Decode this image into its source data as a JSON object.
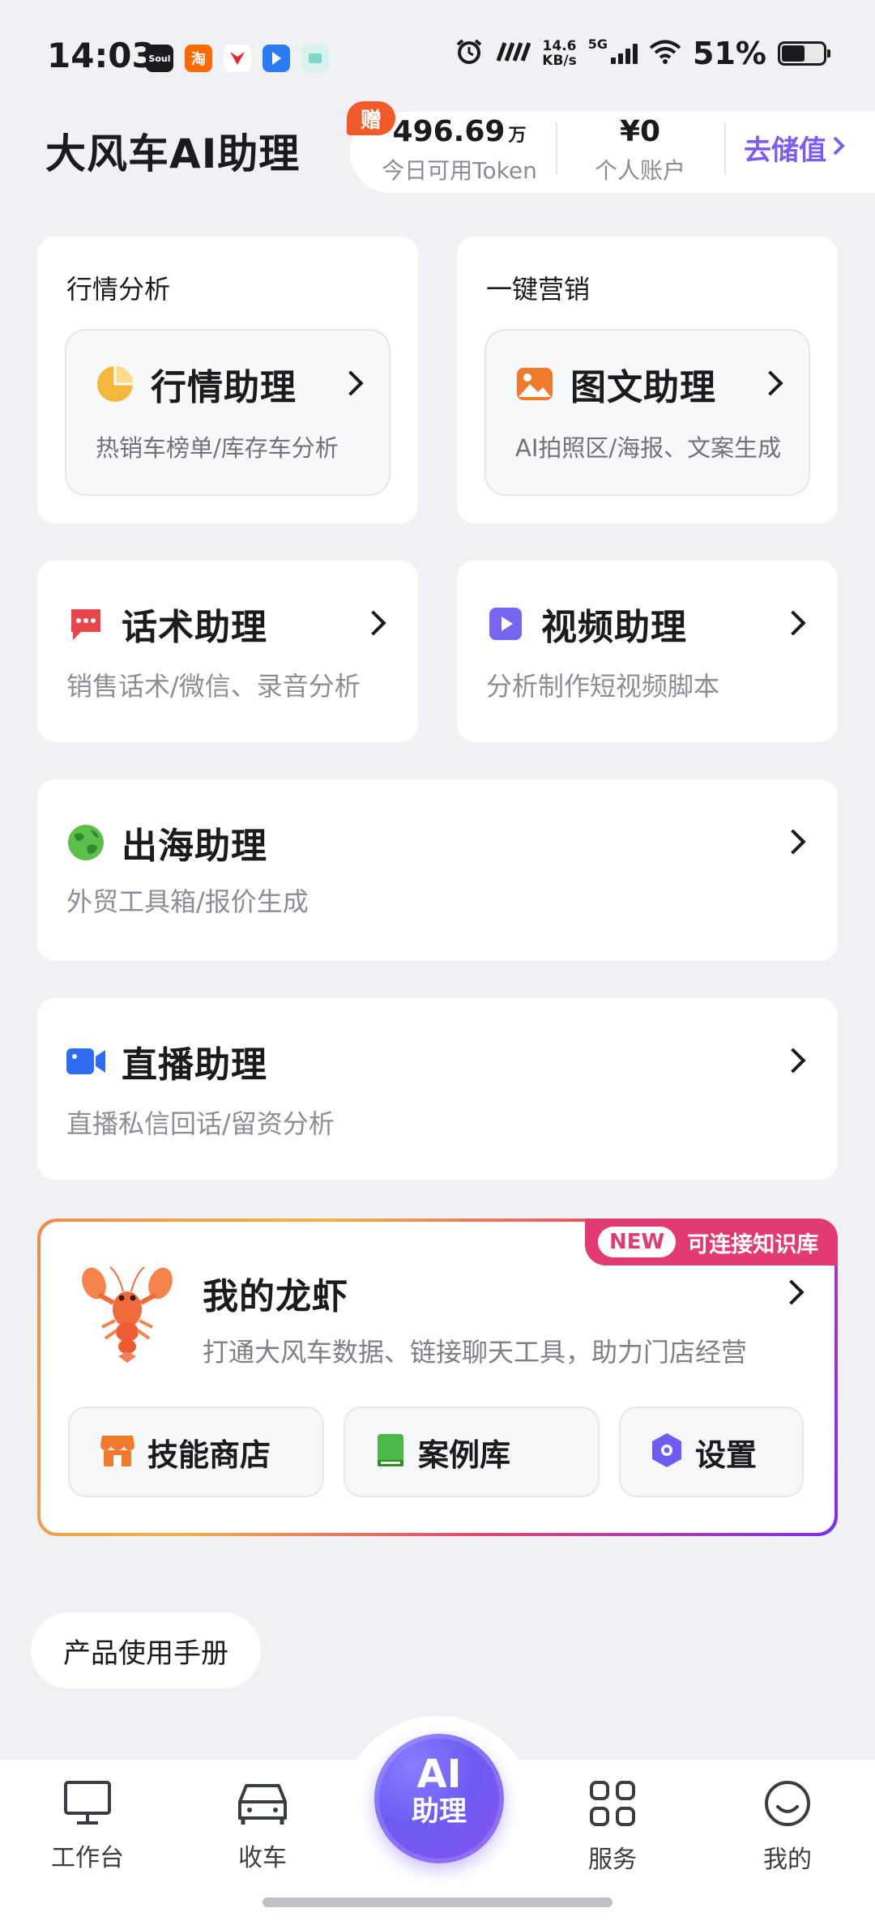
{
  "status_bar": {
    "time": "14:03",
    "apps": [
      {
        "icon": "soul-app-icon",
        "label": "Soul",
        "color": "#1b1b1f"
      },
      {
        "icon": "taobao-app-icon",
        "label": "淘",
        "color": "#ff6a00"
      },
      {
        "icon": "app-red-icon",
        "label": "",
        "color": "#ffffff"
      },
      {
        "icon": "app-blue-icon",
        "label": "",
        "color": "#2b7bf2"
      },
      {
        "icon": "app-teal-icon",
        "label": "",
        "color": "#7fd6c9"
      }
    ],
    "net_speed_value": "14.6",
    "net_speed_unit": "KB/s",
    "network": "5G",
    "battery_percent": "51%"
  },
  "header": {
    "title": "大风车AI助理",
    "gift_badge": "赠",
    "token_value": "496.69",
    "token_unit": "万",
    "token_label": "今日可用Token",
    "account_value": "¥0",
    "account_label": "个人账户",
    "recharge_label": "去储值"
  },
  "market_card": {
    "section_title": "行情分析",
    "title": "行情助理",
    "subtitle": "热销车榜单/库存车分析",
    "icon": "pie-chart-icon",
    "icon_color": "#f5b73b"
  },
  "marketing_card": {
    "section_title": "一键营销",
    "title": "图文助理",
    "subtitle": "AI拍照区/海报、文案生成",
    "icon": "image-icon",
    "icon_color": "#f07a2c"
  },
  "script_card": {
    "title": "话术助理",
    "subtitle": "销售话术/微信、录音分析",
    "icon": "chat-icon",
    "icon_color": "#e8464a"
  },
  "video_card": {
    "title": "视频助理",
    "subtitle": "分析制作短视频脚本",
    "icon": "play-icon",
    "icon_color": "#7466f0"
  },
  "overseas_card": {
    "title": "出海助理",
    "subtitle": "外贸工具箱/报价生成",
    "icon": "globe-icon",
    "icon_color": "#5bbf4a"
  },
  "live_card": {
    "title": "直播助理",
    "subtitle": "直播私信回话/留资分析",
    "icon": "video-camera-icon",
    "icon_color": "#2f6cf0"
  },
  "lobster_card": {
    "new_badge": "NEW",
    "badge_text": "可连接知识库",
    "title": "我的龙虾",
    "subtitle": "打通大风车数据、链接聊天工具，助力门店经营",
    "icon": "lobster-icon",
    "buttons": [
      {
        "label": "技能商店",
        "icon": "store-icon",
        "color": "#f07a2c"
      },
      {
        "label": "案例库",
        "icon": "book-icon",
        "color": "#4cb84a"
      },
      {
        "label": "设置",
        "icon": "settings-hexagon-icon",
        "color": "#6d5cf4"
      }
    ]
  },
  "manual_label": "产品使用手册",
  "bottom_nav": {
    "items": [
      {
        "label": "工作台",
        "icon": "monitor-icon"
      },
      {
        "label": "收车",
        "icon": "car-icon"
      },
      {
        "label": "服务",
        "icon": "grid-icon"
      },
      {
        "label": "我的",
        "icon": "smile-icon"
      }
    ],
    "ai_line1": "AI",
    "ai_line2": "助理"
  }
}
